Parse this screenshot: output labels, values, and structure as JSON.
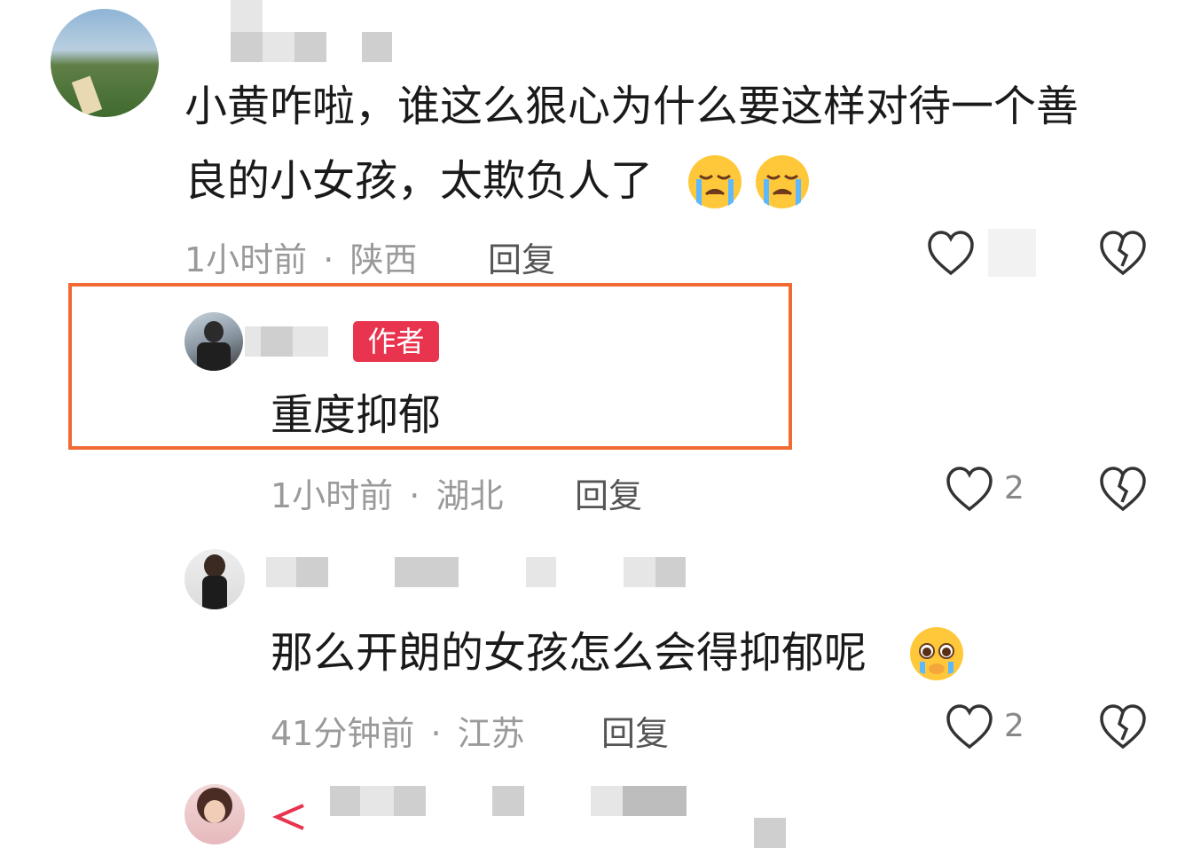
{
  "comments": [
    {
      "text_line1": "小黄咋啦，谁这么狠心为什么要这样对待一个善",
      "text_line2": "良的小女孩，太欺负人了",
      "time": "1小时前",
      "location": "陕西",
      "reply_label": "回复"
    },
    {
      "badge": "作者",
      "text": "重度抑郁",
      "time": "1小时前",
      "location": "湖北",
      "reply_label": "回复",
      "likes": "2"
    },
    {
      "text": "那么开朗的女孩怎么会得抑郁呢",
      "time": "41分钟前",
      "location": "江苏",
      "reply_label": "回复",
      "likes": "2"
    }
  ],
  "separator": "·",
  "colors": {
    "highlight_box": "#f26a33",
    "author_badge": "#e8344e",
    "meta_text": "#9a9a9a"
  },
  "icons": [
    "heart-icon",
    "broken-heart-icon",
    "crying-emoji",
    "pleading-emoji"
  ]
}
